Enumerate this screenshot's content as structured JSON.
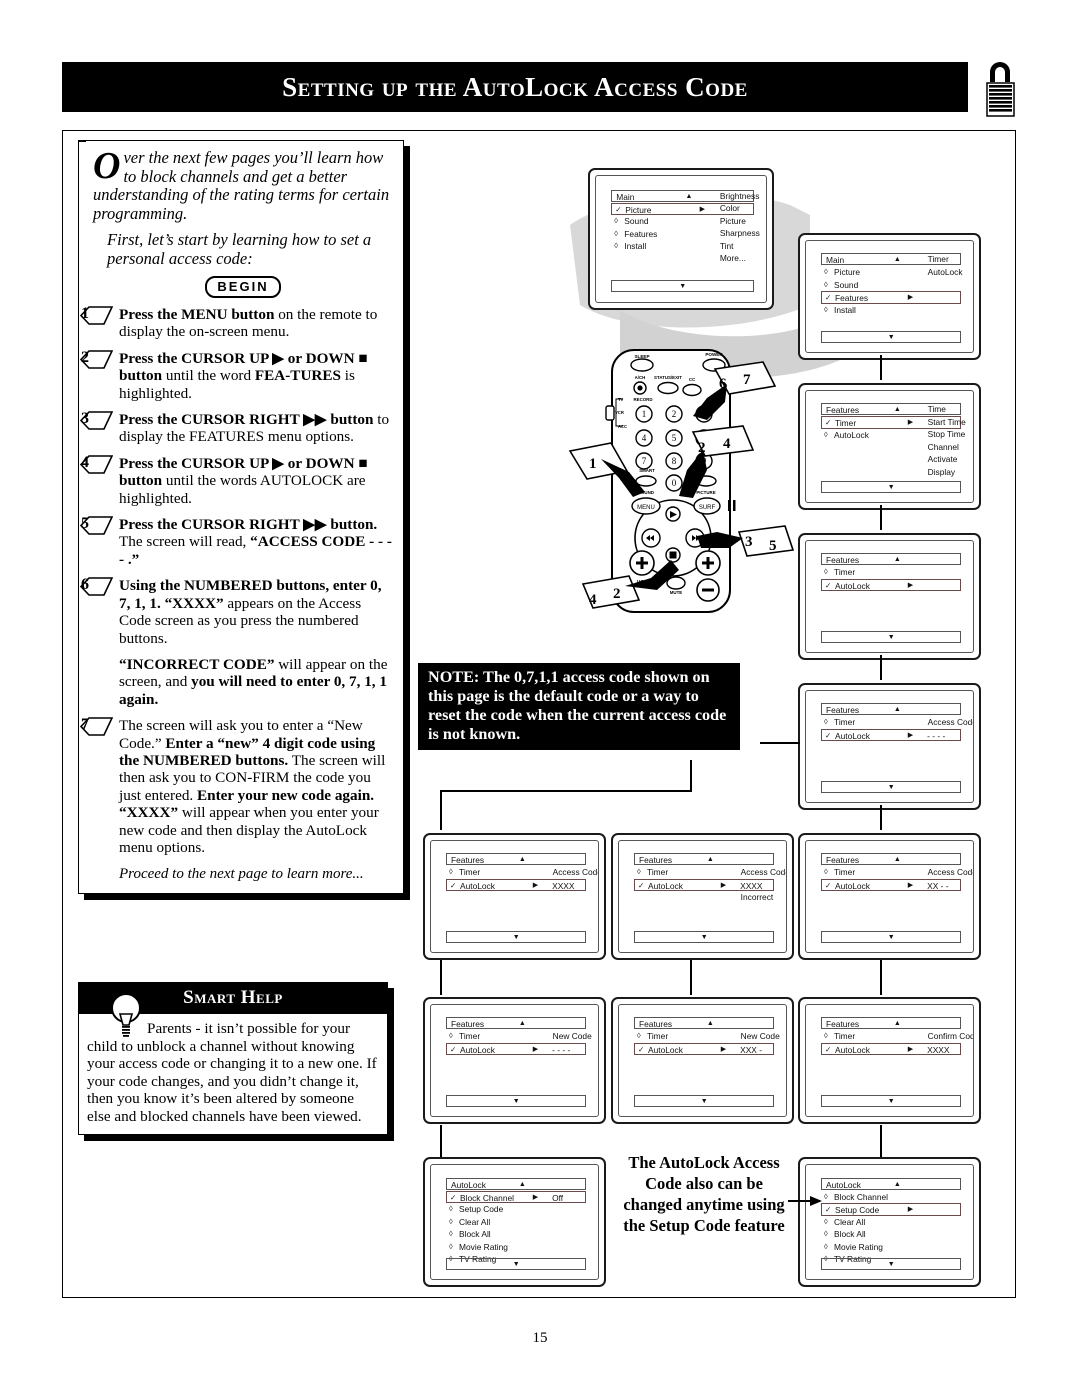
{
  "header": {
    "title": "Setting up the AutoLock Access Code",
    "lock_icon": "padlock-icon"
  },
  "intro": {
    "dropcap": "O",
    "para1": "ver the next few pages you’ll learn how to block channels and get a better understanding of the rating terms for certain programming.",
    "para2": "First, let’s start by learning how to set a personal access code:",
    "begin_label": "BEGIN"
  },
  "steps": [
    {
      "num": "1",
      "html": "<b>Press the MENU button</b> on the remote to display the on-screen menu."
    },
    {
      "num": "2",
      "html": "<b>Press the CURSOR UP ▶ or DOWN ■ button</b> until the word <b>FEA-TURES</b> is highlighted."
    },
    {
      "num": "3",
      "html": "<b>Press the CURSOR RIGHT ▶▶ button</b> to display the FEATURES menu options."
    },
    {
      "num": "4",
      "html": "<b>Press the CURSOR UP ▶ or DOWN ■ button</b> until the words AUTOLOCK are highlighted."
    },
    {
      "num": "5",
      "html": "<b>Press the CURSOR RIGHT ▶▶ button.</b> The screen will read, <b>“ACCESS CODE - - - - .”</b>"
    },
    {
      "num": "6",
      "html": "<b>Using the NUMBERED buttons, enter 0, 7, 1, 1. “XXXX”</b> appears on the Access Code screen as you press the numbered buttons."
    },
    {
      "num": "7",
      "html": "The screen will ask you to enter a “New Code.” <b>Enter a “new” 4 digit code using the NUMBERED buttons.</b> The screen will then ask you to CON-FIRM the code you just entered. <b>Enter your new code again. “XXXX”</b> will appear when you enter your new code and then display the AutoLock menu options."
    }
  ],
  "incorrect_para": "<b>“INCORRECT CODE”</b> will appear on the screen, and <b>you will need to enter 0, 7, 1, 1 again.</b>",
  "proceed": "Proceed to the next page to learn more...",
  "smart_help": {
    "title": "Smart Help",
    "icon": "lightbulb-icon",
    "body": "Parents - it isn’t possible for your child to unblock a channel without knowing your access code or changing it to a new one. If your code changes, and you didn’t change it, then you know it’s been altered by someone else and blocked channels have been viewed."
  },
  "note": "NOTE: The 0,7,1,1 access code shown on this page is the default code or a way to reset the code when the current access code is not known.",
  "caption": "The AutoLock Access Code also can be changed anytime using the Setup Code feature",
  "page_number": "15",
  "remote": {
    "name": "tv-remote-illustration",
    "labels": [
      "SLEEP",
      "POWER",
      "A/CH",
      "STATUS/EXIT",
      "CC",
      "RECORD",
      "TV",
      "VCR",
      "ACC",
      "SMART",
      "SOUND",
      "PICTURE",
      "MENU",
      "SURF",
      "VOL",
      "CH",
      "MUTE"
    ],
    "keypad": [
      "1",
      "2",
      "3",
      "4",
      "5",
      "6",
      "7",
      "8",
      "9",
      "0"
    ],
    "callouts": [
      "1",
      "2",
      "3",
      "4",
      "5",
      "6",
      "7"
    ]
  },
  "screens": [
    {
      "id": "screen-main-picture",
      "title": "Main",
      "up_arrow": "▲",
      "down_arrow": "▼",
      "rows": [
        {
          "mark": "✓",
          "label": "Picture",
          "arrow": "▶",
          "selected": true
        },
        {
          "mark": "◊",
          "label": "Sound",
          "selected": false
        },
        {
          "mark": "◊",
          "label": "Features",
          "selected": false
        },
        {
          "mark": "◊",
          "label": "Install",
          "selected": false
        }
      ],
      "right_column": [
        "Brightness",
        "Color",
        "Picture",
        "Sharpness",
        "Tint",
        "More..."
      ]
    },
    {
      "id": "screen-main-features",
      "title": "Main",
      "up_arrow": "▲",
      "down_arrow": "▼",
      "rows": [
        {
          "mark": "◊",
          "label": "Picture",
          "selected": false
        },
        {
          "mark": "◊",
          "label": "Sound",
          "selected": false
        },
        {
          "mark": "✓",
          "label": "Features",
          "arrow": "▶",
          "selected": true
        },
        {
          "mark": "◊",
          "label": "Install",
          "selected": false
        }
      ],
      "right_column": [
        "Timer",
        "AutoLock"
      ]
    },
    {
      "id": "screen-features-timer",
      "title": "Features",
      "up_arrow": "▲",
      "down_arrow": "▼",
      "rows": [
        {
          "mark": "✓",
          "label": "Timer",
          "arrow": "▶",
          "selected": true
        },
        {
          "mark": "◊",
          "label": "AutoLock",
          "selected": false
        }
      ],
      "right_column": [
        "Time",
        "Start Time",
        "Stop Time",
        "Channel",
        "Activate",
        "Display"
      ]
    },
    {
      "id": "screen-features-autolock",
      "title": "Features",
      "up_arrow": "▲",
      "down_arrow": "▼",
      "rows": [
        {
          "mark": "◊",
          "label": "Timer",
          "selected": false
        },
        {
          "mark": "✓",
          "label": "AutoLock",
          "arrow": "▶",
          "selected": true
        }
      ],
      "right_column": []
    },
    {
      "id": "screen-access-code-empty",
      "title": "Features",
      "up_arrow": "▲",
      "down_arrow": "▼",
      "rows": [
        {
          "mark": "◊",
          "label": "Timer",
          "selected": false,
          "rval": "Access Code"
        },
        {
          "mark": "✓",
          "label": "AutoLock",
          "arrow": "▶",
          "selected": true,
          "rval": "- - - -"
        }
      ],
      "right_column": []
    },
    {
      "id": "screen-access-code-xxxx",
      "title": "Features",
      "up_arrow": "▲",
      "down_arrow": "▼",
      "rows": [
        {
          "mark": "◊",
          "label": "Timer",
          "selected": false,
          "rval": "Access Code"
        },
        {
          "mark": "✓",
          "label": "AutoLock",
          "arrow": "▶",
          "selected": true,
          "rval": "XXXX"
        }
      ],
      "right_column": []
    },
    {
      "id": "screen-access-code-incorrect",
      "title": "Features",
      "up_arrow": "▲",
      "down_arrow": "▼",
      "rows": [
        {
          "mark": "◊",
          "label": "Timer",
          "selected": false,
          "rval": "Access Code"
        },
        {
          "mark": "✓",
          "label": "AutoLock",
          "arrow": "▶",
          "selected": true,
          "rval": "XXXX"
        },
        {
          "mark": "",
          "label": "",
          "selected": false,
          "rval": "Incorrect"
        }
      ],
      "right_column": []
    },
    {
      "id": "screen-access-code-partial",
      "title": "Features",
      "up_arrow": "▲",
      "down_arrow": "▼",
      "rows": [
        {
          "mark": "◊",
          "label": "Timer",
          "selected": false,
          "rval": "Access Code"
        },
        {
          "mark": "✓",
          "label": "AutoLock",
          "arrow": "▶",
          "selected": true,
          "rval": "XX - -"
        }
      ],
      "right_column": []
    },
    {
      "id": "screen-new-code-empty",
      "title": "Features",
      "up_arrow": "▲",
      "down_arrow": "▼",
      "rows": [
        {
          "mark": "◊",
          "label": "Timer",
          "selected": false,
          "rval": "New Code"
        },
        {
          "mark": "✓",
          "label": "AutoLock",
          "arrow": "▶",
          "selected": true,
          "rval": "- - - -"
        }
      ],
      "right_column": []
    },
    {
      "id": "screen-new-code-partial",
      "title": "Features",
      "up_arrow": "▲",
      "down_arrow": "▼",
      "rows": [
        {
          "mark": "◊",
          "label": "Timer",
          "selected": false,
          "rval": "New Code"
        },
        {
          "mark": "✓",
          "label": "AutoLock",
          "arrow": "▶",
          "selected": true,
          "rval": "XXX -"
        }
      ],
      "right_column": []
    },
    {
      "id": "screen-confirm-code",
      "title": "Features",
      "up_arrow": "▲",
      "down_arrow": "▼",
      "rows": [
        {
          "mark": "◊",
          "label": "Timer",
          "selected": false,
          "rval": "Confirm Code"
        },
        {
          "mark": "✓",
          "label": "AutoLock",
          "arrow": "▶",
          "selected": true,
          "rval": "XXXX"
        }
      ],
      "right_column": []
    },
    {
      "id": "screen-autolock-block-channel",
      "title": "AutoLock",
      "up_arrow": "▲",
      "down_arrow": "▼",
      "rows": [
        {
          "mark": "✓",
          "label": "Block Channel",
          "arrow": "▶",
          "selected": true,
          "rval": "Off"
        },
        {
          "mark": "◊",
          "label": "Setup Code",
          "selected": false
        },
        {
          "mark": "◊",
          "label": "Clear All",
          "selected": false
        },
        {
          "mark": "◊",
          "label": "Block All",
          "selected": false
        },
        {
          "mark": "◊",
          "label": "Movie Rating",
          "selected": false
        },
        {
          "mark": "◊",
          "label": "TV Rating",
          "selected": false
        }
      ],
      "right_column": []
    },
    {
      "id": "screen-autolock-setup-code",
      "title": "AutoLock",
      "up_arrow": "▲",
      "down_arrow": "▼",
      "rows": [
        {
          "mark": "◊",
          "label": "Block Channel",
          "selected": false
        },
        {
          "mark": "✓",
          "label": "Setup Code",
          "arrow": "▶",
          "selected": true
        },
        {
          "mark": "◊",
          "label": "Clear All",
          "selected": false
        },
        {
          "mark": "◊",
          "label": "Block All",
          "selected": false
        },
        {
          "mark": "◊",
          "label": "Movie Rating",
          "selected": false
        },
        {
          "mark": "◊",
          "label": "TV Rating",
          "selected": false
        }
      ],
      "right_column": []
    }
  ]
}
